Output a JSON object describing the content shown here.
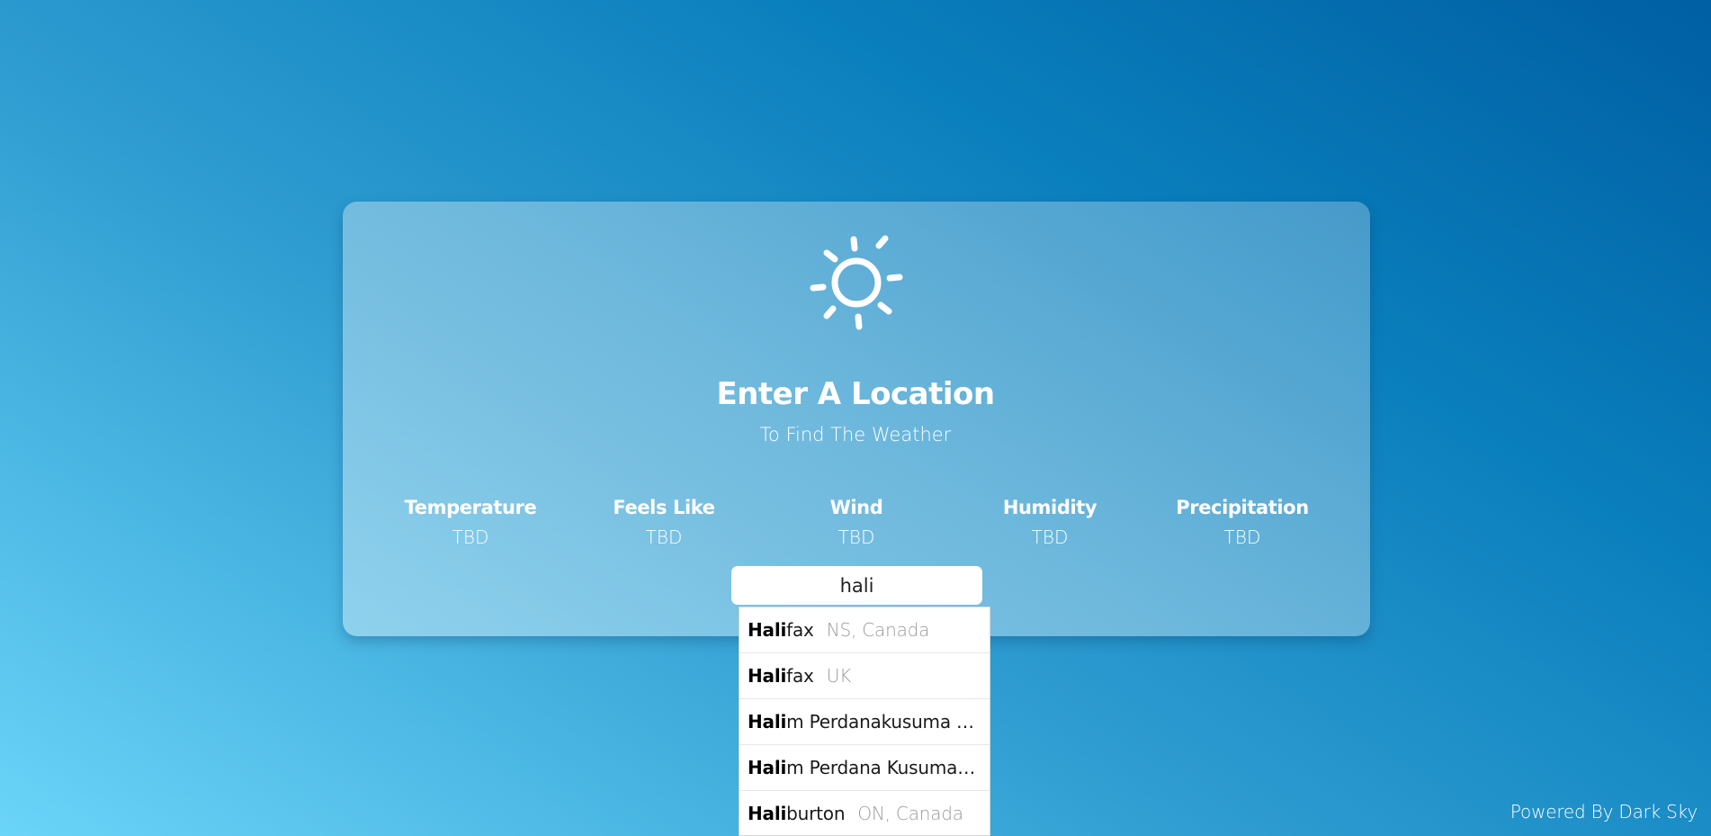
{
  "header": {
    "title": "Enter A Location",
    "subtitle": "To Find The Weather",
    "weather_icon": "sun-icon"
  },
  "stats": [
    {
      "label": "Temperature",
      "value": "TBD"
    },
    {
      "label": "Feels Like",
      "value": "TBD"
    },
    {
      "label": "Wind",
      "value": "TBD"
    },
    {
      "label": "Humidity",
      "value": "TBD"
    },
    {
      "label": "Precipitation",
      "value": "TBD"
    }
  ],
  "search": {
    "value": "hali",
    "placeholder": ""
  },
  "suggestions": [
    {
      "match": "Hali",
      "rest": "fax",
      "region": "NS, Canada"
    },
    {
      "match": "Hali",
      "rest": "fax",
      "region": "UK"
    },
    {
      "match": "Hali",
      "rest": "m Perdanakusuma Airport",
      "region": ""
    },
    {
      "match": "Hali",
      "rest": "m Perdana Kusumah Airport",
      "region": ""
    },
    {
      "match": "Hali",
      "rest": "burton",
      "region": "ON, Canada"
    }
  ],
  "footer": {
    "powered_by": "Powered By Dark Sky"
  },
  "colors": {
    "background_dark": "#005fa3",
    "background_light": "#6bd4f8",
    "text": "#ffffff",
    "suggestion_region": "#9b9b9b"
  }
}
